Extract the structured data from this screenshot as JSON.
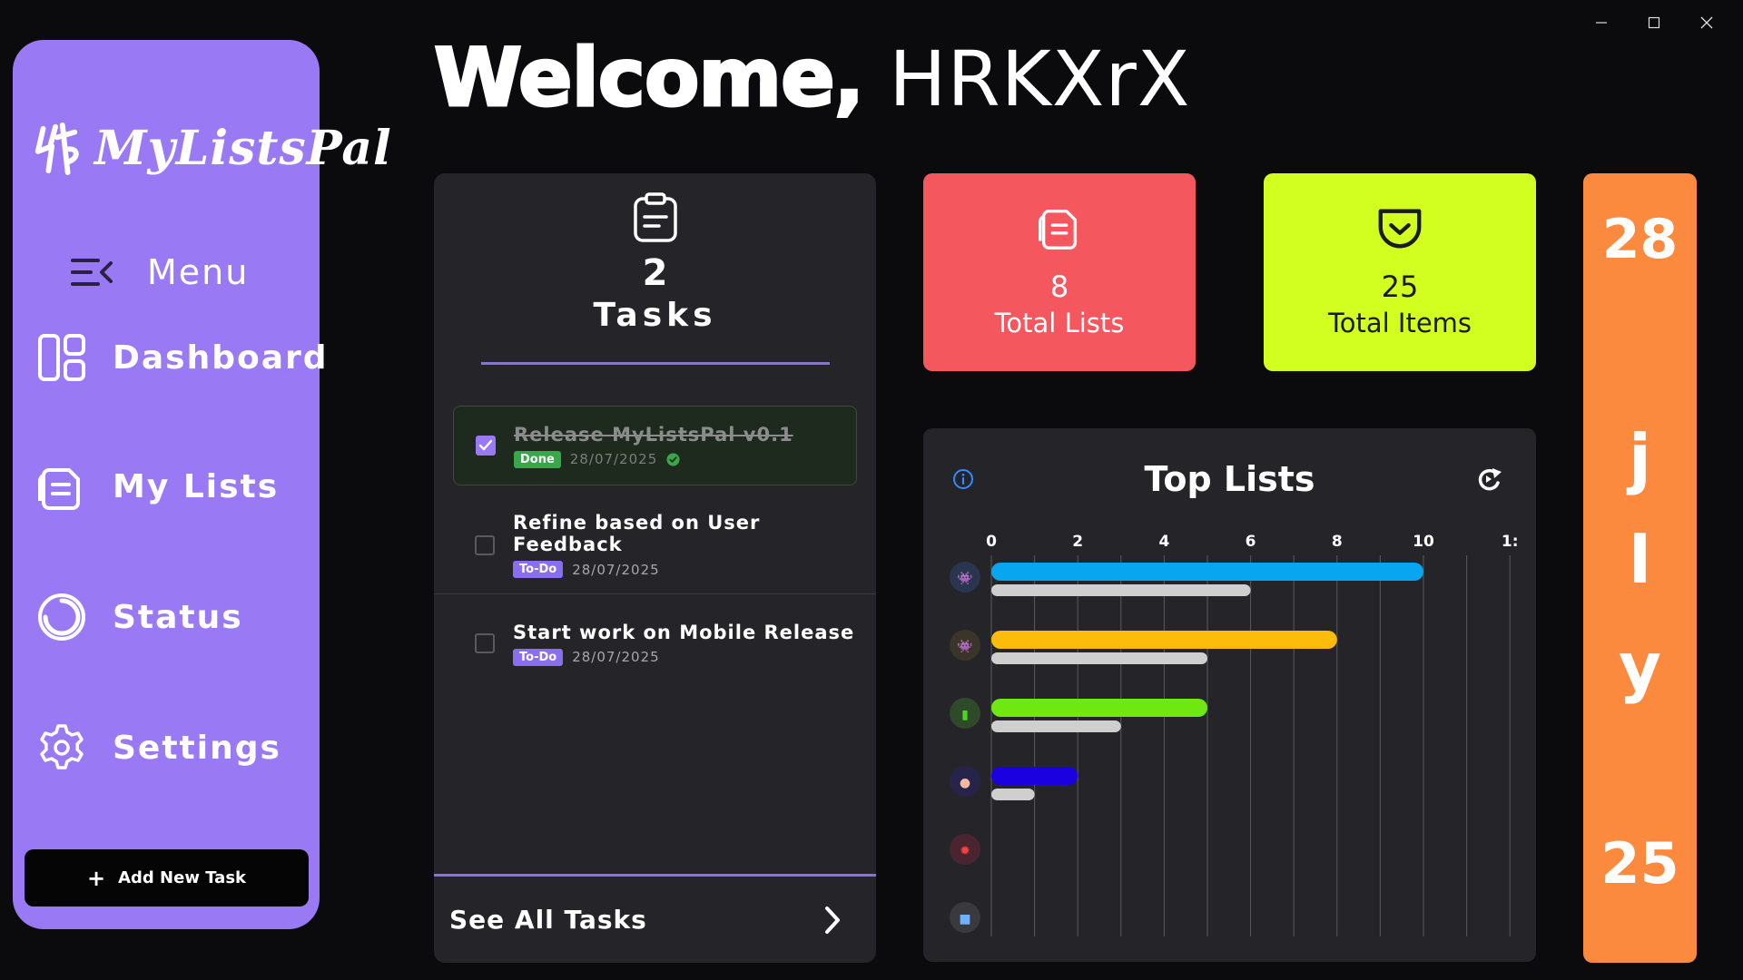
{
  "user": {
    "welcome_word": "Welcome,",
    "username": "HRKXrX"
  },
  "sidebar": {
    "brand": "MyListsPal",
    "menu_label": "Menu",
    "items": [
      {
        "label": "Dashboard",
        "icon": "dashboard-icon"
      },
      {
        "label": "My Lists",
        "icon": "lists-icon"
      },
      {
        "label": "Status",
        "icon": "status-icon"
      },
      {
        "label": "Settings",
        "icon": "gear-icon"
      }
    ],
    "add_task_label": "Add New Task"
  },
  "tasks": {
    "count": "2",
    "title": "Tasks",
    "items": [
      {
        "title": "Release MyListsPal v0.1",
        "status": "Done",
        "date": "28/07/2025",
        "checked": true
      },
      {
        "title": "Refine based on User Feedback",
        "status": "To-Do",
        "date": "28/07/2025",
        "checked": false
      },
      {
        "title": "Start work on Mobile Release",
        "status": "To-Do",
        "date": "28/07/2025",
        "checked": false
      }
    ],
    "see_all_label": "See All Tasks"
  },
  "stats": {
    "total_lists": {
      "value": "8",
      "label": "Total Lists"
    },
    "total_items": {
      "value": "25",
      "label": "Total Items"
    }
  },
  "colors": {
    "sidebar": "#9a79f5",
    "accent": "#8a6ef0",
    "stat_lists": "#f4575e",
    "stat_items": "#d2ff1f",
    "date_card": "#fb8a3e",
    "done_badge": "#3aa64a"
  },
  "date_card": {
    "day": "28",
    "month_letters": [
      "j",
      "l",
      "y"
    ],
    "year": "25"
  },
  "chart_data": {
    "type": "bar",
    "orientation": "horizontal",
    "title": "Top Lists",
    "xlim": [
      0,
      12
    ],
    "x_ticks": [
      "0",
      "2",
      "4",
      "6",
      "8",
      "10",
      "1:"
    ],
    "grid": true,
    "categories": [
      "list-1",
      "list-2",
      "list-3",
      "list-4",
      "list-5",
      "list-6"
    ],
    "category_icons": [
      "gamepad-icon",
      "robot-icon",
      "book-icon",
      "muscle-icon",
      "burst-icon",
      "tv-icon"
    ],
    "series": [
      {
        "values": [
          10,
          8,
          5,
          2,
          0,
          0
        ],
        "colors": [
          "#08a6f0",
          "#fdbc0b",
          "#6fe812",
          "#1b00e0",
          "#888888",
          "#888888"
        ]
      },
      {
        "values": [
          6,
          5,
          3,
          1,
          0,
          0
        ],
        "color": "#cfcfcf"
      }
    ]
  }
}
